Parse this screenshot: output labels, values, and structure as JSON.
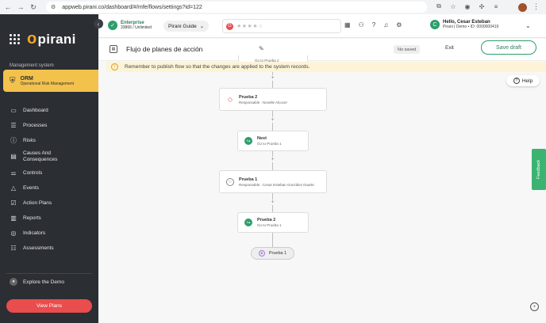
{
  "browser": {
    "url": "appweb.pirani.co/dashboard/#/mfe/flows/settings?id=122"
  },
  "sidebar": {
    "logo": "pirani",
    "section_label": "Management system",
    "module": {
      "title": "ORM",
      "subtitle": "Operational Risk Management"
    },
    "items": [
      {
        "label": "Dashboard",
        "icon": "monitor-icon"
      },
      {
        "label": "Processes",
        "icon": "process-icon"
      },
      {
        "label": "Risks",
        "icon": "alert-circle-icon"
      },
      {
        "label": "Causes And Consequences",
        "icon": "cause-icon"
      },
      {
        "label": "Controls",
        "icon": "sliders-icon"
      },
      {
        "label": "Events",
        "icon": "warning-triangle-icon"
      },
      {
        "label": "Action Plans",
        "icon": "checkbox-icon"
      },
      {
        "label": "Reports",
        "icon": "bar-chart-icon"
      },
      {
        "label": "Indicators",
        "icon": "target-icon"
      },
      {
        "label": "Assessments",
        "icon": "list-check-icon"
      }
    ],
    "explore_label": "Explore the Demo",
    "view_plans_label": "View Plans"
  },
  "topbar": {
    "plan_name": "Enterprise",
    "plan_count": "33866 / Unlimited",
    "guide_label": "Pirani Guide",
    "user_greeting": "Hello, Cesar Esteban",
    "user_sub": "Pirani | Demo • ID: 0000000419",
    "user_initial": "C"
  },
  "header": {
    "title": "Flujo de planes de acción",
    "status_badge": "No saved",
    "exit_label": "Exit",
    "save_label": "Save draft"
  },
  "banner": {
    "message": "Remember to publish flow so that the changes are applied to the system records."
  },
  "help_label": "Help",
  "feedback_label": "Feedback",
  "flow": {
    "partial_top_sub": "Go to Prueba 2",
    "nodes": [
      {
        "title": "Prueba 2",
        "sub": "Responsable : Novelle Alcocer"
      },
      {
        "title": "Next",
        "sub": "Go to Prueba 1"
      },
      {
        "title": "Prueba 1",
        "sub": "Responsable : Cesar Esteban  González Duarte"
      },
      {
        "title": "Prueba 2",
        "sub": "Go to Prueba 1"
      }
    ],
    "end_node": "Prueba 1"
  }
}
